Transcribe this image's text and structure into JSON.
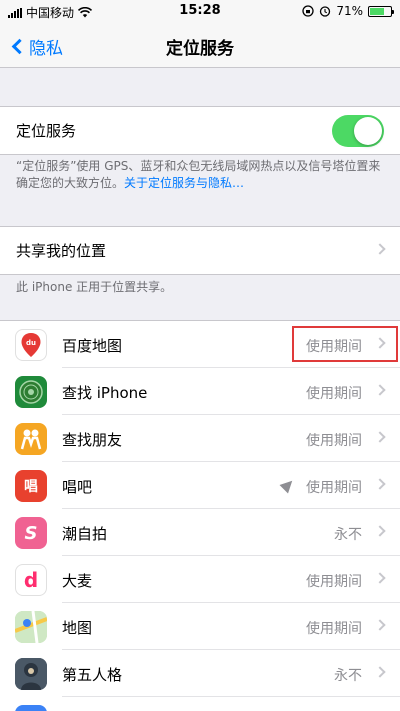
{
  "status_bar": {
    "carrier": "中国移动",
    "time": "15:28",
    "battery_percent": "71%",
    "battery_level": 0.71,
    "icons": [
      "wifi-icon",
      "rotation-lock-icon",
      "alarm-icon",
      "battery-icon"
    ]
  },
  "nav": {
    "back_label": "隐私",
    "title": "定位服务"
  },
  "location_services": {
    "label": "定位服务",
    "enabled": true,
    "description": "“定位服务”使用 GPS、蓝牙和众包无线局域网热点以及信号塔位置来确定您的大致方位。",
    "link": "关于定位服务与隐私…"
  },
  "share_location": {
    "label": "共享我的位置",
    "footer": "此 iPhone 正用于位置共享。"
  },
  "apps": [
    {
      "name": "百度地图",
      "value": "使用期间",
      "icon": "baidu-maps-icon",
      "color": "#ffffff",
      "highlighted": true
    },
    {
      "name": "查找 iPhone",
      "value": "使用期间",
      "icon": "find-iphone-icon",
      "color": "#1f8a3a"
    },
    {
      "name": "查找朋友",
      "value": "使用期间",
      "icon": "find-friends-icon",
      "color": "#f5a623"
    },
    {
      "name": "唱吧",
      "value": "使用期间",
      "icon": "changba-icon",
      "color": "#e8412e",
      "glyph": "唱",
      "recent_location": true
    },
    {
      "name": "潮自拍",
      "value": "永不",
      "icon": "chaozipai-icon",
      "color": "#f06292",
      "glyph": "S"
    },
    {
      "name": "大麦",
      "value": "使用期间",
      "icon": "damai-icon",
      "color": "#ffffff",
      "glyph": "d"
    },
    {
      "name": "地图",
      "value": "使用期间",
      "icon": "apple-maps-icon",
      "color": "#7fc97f"
    },
    {
      "name": "第五人格",
      "value": "永不",
      "icon": "identity-v-icon",
      "color": "#5a6b7a"
    }
  ],
  "colors": {
    "accent": "#007aff",
    "toggle_on": "#4cd964",
    "highlight": "#e03a3a"
  }
}
